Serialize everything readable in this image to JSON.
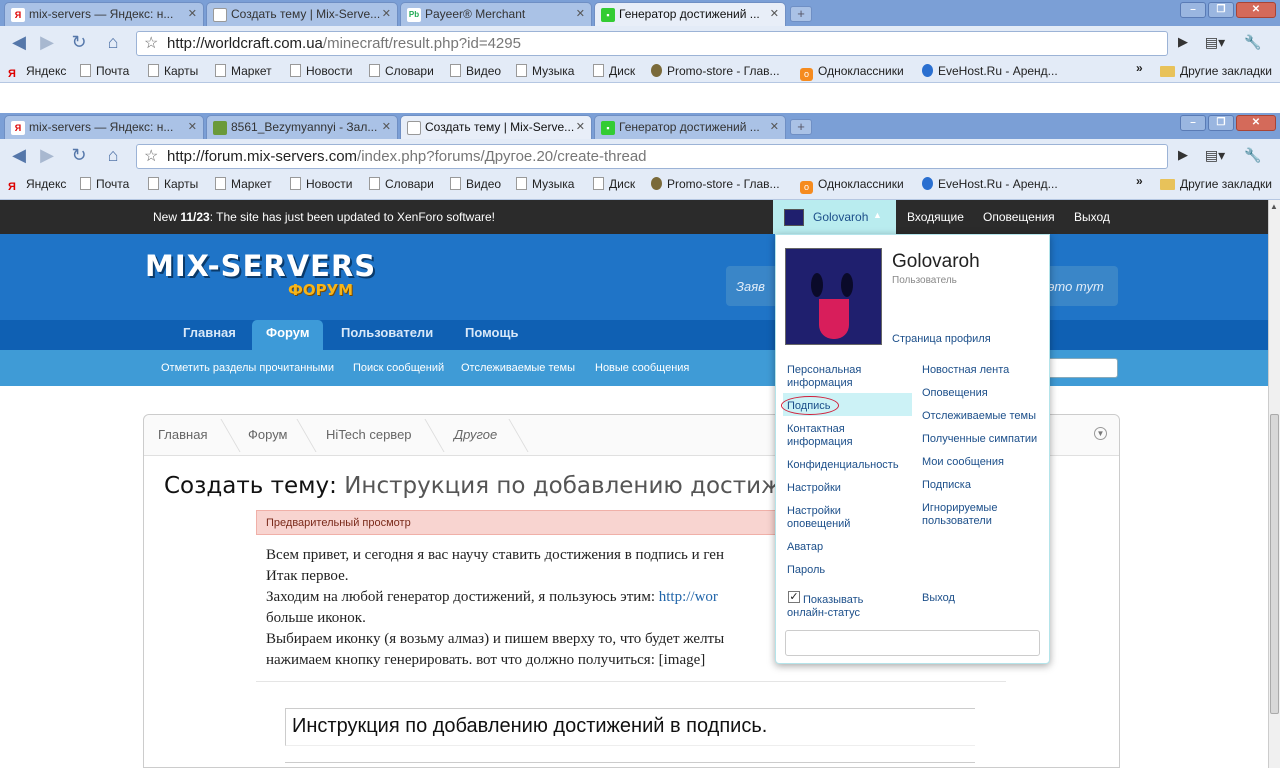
{
  "browser1": {
    "tabs": [
      {
        "favicon": "yandex-icon",
        "label": "mix-servers — Яндекс: н..."
      },
      {
        "favicon": "page-icon",
        "label": "Создать тему | Mix-Serve..."
      },
      {
        "favicon": "payeer-icon",
        "label": "Payeer® Merchant"
      },
      {
        "favicon": "creeper-icon",
        "label": "Генератор достижений ..."
      }
    ],
    "url_domain": "http://worldcraft.com.ua",
    "url_path": "/minecraft/result.php?id=4295"
  },
  "browser2": {
    "tabs": [
      {
        "favicon": "yandex-icon",
        "label": "mix-servers — Яндекс: н..."
      },
      {
        "favicon": "image-icon",
        "label": "8561_Bezymyannyi - Зал..."
      },
      {
        "favicon": "page-icon",
        "label": "Создать тему | Mix-Serve..."
      },
      {
        "favicon": "creeper-icon",
        "label": "Генератор достижений ..."
      }
    ],
    "url_domain": "http://forum.mix-servers.com",
    "url_path": "/index.php?forums/Другое.20/create-thread"
  },
  "bookmarks": [
    "Яндекс",
    "Почта",
    "Карты",
    "Маркет",
    "Новости",
    "Словари",
    "Видео",
    "Музыка",
    "Диск",
    "Promo-store - Глав...",
    "Одноклассники",
    "EveHost.Ru - Аренд..."
  ],
  "bookmarks_more": "»",
  "bookmarks_other": "Другие закладки",
  "xf_notice": {
    "prefix": "New ",
    "count": "11/23",
    "text": ": The site has just been updated to XenForo software!"
  },
  "user": {
    "name": "Golovaroh",
    "role": "Пользователь",
    "profile_link": "Страница профиля"
  },
  "top_links": [
    "Входящие",
    "Оповещения",
    "Выход"
  ],
  "logo": {
    "main": "MIX-SERVERS",
    "sub": "ФОРУМ"
  },
  "search_left": "Заяв",
  "search_right": "это тут",
  "nav_tabs": [
    "Главная",
    "Форум",
    "Пользователи",
    "Помощь"
  ],
  "sub_nav": [
    "Отметить разделы прочитанными",
    "Поиск сообщений",
    "Отслеживаемые темы",
    "Новые сообщения"
  ],
  "breadcrumbs": [
    "Главная",
    "Форум",
    "HiTech сервер",
    "Другое"
  ],
  "page_title": {
    "prefix": "Создать тему:",
    "title": "Инструкция по добавлению достиж"
  },
  "preview_label": "Предварительный просмотр",
  "post_lines": [
    "Всем привет, и сегодня я вас научу ставить достижения в подпись и ген",
    "Итак первое.",
    "Заходим на любой генератор достижений, я пользуюсь этим: ",
    "больше иконок.",
    "Выбираем иконку (я возьму алмаз) и пишем вверху то, что будет желты",
    "нажимаем кнопку генерировать. вот что должно получиться: [image]"
  ],
  "post_link": "http://wor",
  "title_field": "Инструкция по добавлению достижений в подпись.",
  "popup_left": [
    "Персональная информация",
    "Подпись",
    "Контактная информация",
    "Конфиденциальность",
    "Настройки",
    "Настройки оповещений",
    "Аватар",
    "Пароль"
  ],
  "popup_right": [
    "Новостная лента",
    "Оповещения",
    "Отслеживаемые темы",
    "Полученные симпатии",
    "Мои сообщения",
    "Подписка",
    "Игнорируемые пользователи"
  ],
  "show_status": "Показывать онлайн-статус",
  "logout": "Выход",
  "highlight_color": "#ccf2f6",
  "circle_color": "#d0203a"
}
